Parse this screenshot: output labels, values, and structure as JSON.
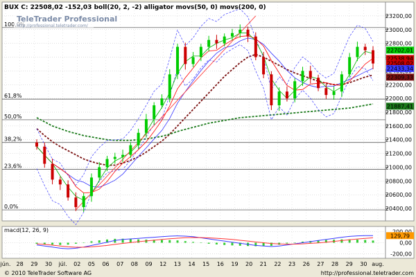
{
  "header": {
    "title": "BUX C: 22508,02 -152,03 boll(20, 2, -2) alligator movs(50, 0) movs(200, 0)",
    "watermark_brand": "TeleTrader Professional",
    "watermark_url": "http://professional.teletrader.com/"
  },
  "footer": {
    "copyright": "© 2010 TeleTrader Software AG",
    "url": "http://professional.teletrader.com"
  },
  "colors": {
    "bg": "#ffffff",
    "frame_bg": "#ece9d8",
    "grid": "#b0b0b0",
    "up": "#00cc00",
    "down": "#cc0000",
    "ma50": "#7a1010",
    "ma200": "#1a7a1a",
    "boll": "#3a3aff",
    "alligator_jaw": "#3333ff",
    "alligator_teeth": "#ff0000",
    "alligator_lips": "#00b000",
    "trendline": "#ff4040",
    "macd": "#3a3aff",
    "signal": "#ff3333",
    "hist": "#33cc33"
  },
  "chart_data": [
    {
      "type": "candlestick",
      "title": "BUX C: 22508,02 -152,03 boll(20, 2, -2) alligator movs(50, 0) movs(200, 0)",
      "ylim": [
        20250,
        23350
      ],
      "yticks": [
        20400,
        20600,
        20800,
        21000,
        21200,
        21400,
        21600,
        21800,
        22000,
        22200,
        22400,
        22600,
        22800,
        23000,
        23200
      ],
      "ytick_labels": [
        "20400,00",
        "20600,00",
        "20800,00",
        "21000,00",
        "21200,00",
        "21400,00",
        "21600,00",
        "21800,00",
        "22000,00",
        "22200,00",
        "22400,00",
        "22600,00",
        "22800,00",
        "23000,00",
        "23200,00"
      ],
      "x_labels": [
        "jún.",
        "28",
        "29",
        "30",
        "júl.",
        "02",
        "05",
        "06",
        "07",
        "08",
        "09",
        "12",
        "13",
        "14",
        "15",
        "16",
        "19",
        "20",
        "21",
        "22",
        "23",
        "26",
        "27",
        "28",
        "29",
        "30",
        "aug."
      ],
      "fib_levels": [
        {
          "label": "100,0%",
          "value": 23030
        },
        {
          "label": "61,8%",
          "value": 21990
        },
        {
          "label": "50,0%",
          "value": 21690
        },
        {
          "label": "38,2%",
          "value": 21360
        },
        {
          "label": "23,6%",
          "value": 20970
        },
        {
          "label": "0,0%",
          "value": 20380
        }
      ],
      "series": [
        {
          "name": "close",
          "values": [
            21300,
            21050,
            20820,
            20750,
            20560,
            20420,
            20580,
            20850,
            21000,
            21120,
            21150,
            21180,
            21320,
            21500,
            21700,
            21900,
            22000,
            22350,
            22750,
            22500,
            22600,
            22750,
            22850,
            22800,
            22900,
            22950,
            23000,
            22900,
            22600,
            22350,
            21900,
            22100,
            22000,
            22250,
            22400,
            22300,
            22150,
            22050,
            22100,
            22350,
            22600,
            22750,
            22700,
            22508
          ]
        },
        {
          "name": "ma50",
          "values": [
            21560,
            21460,
            21370,
            21300,
            21240,
            21180,
            21120,
            21080,
            21050,
            21030,
            21030,
            21060,
            21100,
            21150,
            21220,
            21300,
            21380,
            21480,
            21600,
            21720,
            21840,
            21960,
            22080,
            22200,
            22320,
            22420,
            22520,
            22600,
            22640,
            22600,
            22540,
            22480,
            22420,
            22370,
            22330,
            22290,
            22250,
            22220,
            22200,
            22200,
            22230,
            22270,
            22310,
            22340
          ]
        },
        {
          "name": "ma200",
          "values": [
            21720,
            21660,
            21600,
            21560,
            21520,
            21490,
            21460,
            21440,
            21420,
            21400,
            21390,
            21390,
            21390,
            21400,
            21410,
            21430,
            21450,
            21480,
            21520,
            21550,
            21580,
            21610,
            21640,
            21660,
            21680,
            21700,
            21720,
            21730,
            21740,
            21750,
            21760,
            21770,
            21780,
            21790,
            21800,
            21810,
            21820,
            21830,
            21840,
            21850,
            21860,
            21880,
            21900,
            21920
          ]
        }
      ],
      "price_tags": [
        {
          "label": "22702,01",
          "value": 22702,
          "color": "#00cc00"
        },
        {
          "label": "22538,94",
          "value": 22580,
          "color": "#cc0000"
        },
        {
          "label": "22508,02",
          "value": 22508,
          "color": "#cc0000"
        },
        {
          "label": "22433,34",
          "value": 22433,
          "color": "#3a3aff"
        },
        {
          "label": "22309,33",
          "value": 22309,
          "color": "#7a1010"
        },
        {
          "label": "21887,41",
          "value": 21887,
          "color": "#1a7a1a"
        }
      ]
    },
    {
      "type": "line",
      "title": "macd(12, 26, 9)",
      "ylim": [
        -260,
        260
      ],
      "yticks": [
        200,
        0,
        -200
      ],
      "ytick_labels": [
        "200,00",
        "0,00",
        "-200,00"
      ],
      "price_tag": {
        "label": "129,79",
        "value": 129.79
      },
      "series": [
        {
          "name": "macd",
          "values": [
            -40,
            -60,
            -80,
            -100,
            -110,
            -100,
            -80,
            -50,
            -20,
            10,
            40,
            60,
            70,
            80,
            90,
            100,
            110,
            120,
            125,
            120,
            110,
            90,
            70,
            50,
            30,
            10,
            -10,
            -30,
            -50,
            -60,
            -70,
            -60,
            -40,
            -20,
            0,
            20,
            40,
            60,
            80,
            100,
            115,
            125,
            130,
            129.79
          ]
        },
        {
          "name": "signal",
          "values": [
            -20,
            -30,
            -45,
            -60,
            -75,
            -82,
            -82,
            -76,
            -64,
            -49,
            -31,
            -13,
            4,
            19,
            33,
            46,
            59,
            72,
            83,
            91,
            95,
            94,
            89,
            81,
            71,
            59,
            45,
            30,
            14,
            0,
            -14,
            -23,
            -26,
            -25,
            -20,
            -12,
            -2,
            10,
            24,
            39,
            54,
            68,
            80,
            90
          ]
        }
      ]
    }
  ]
}
